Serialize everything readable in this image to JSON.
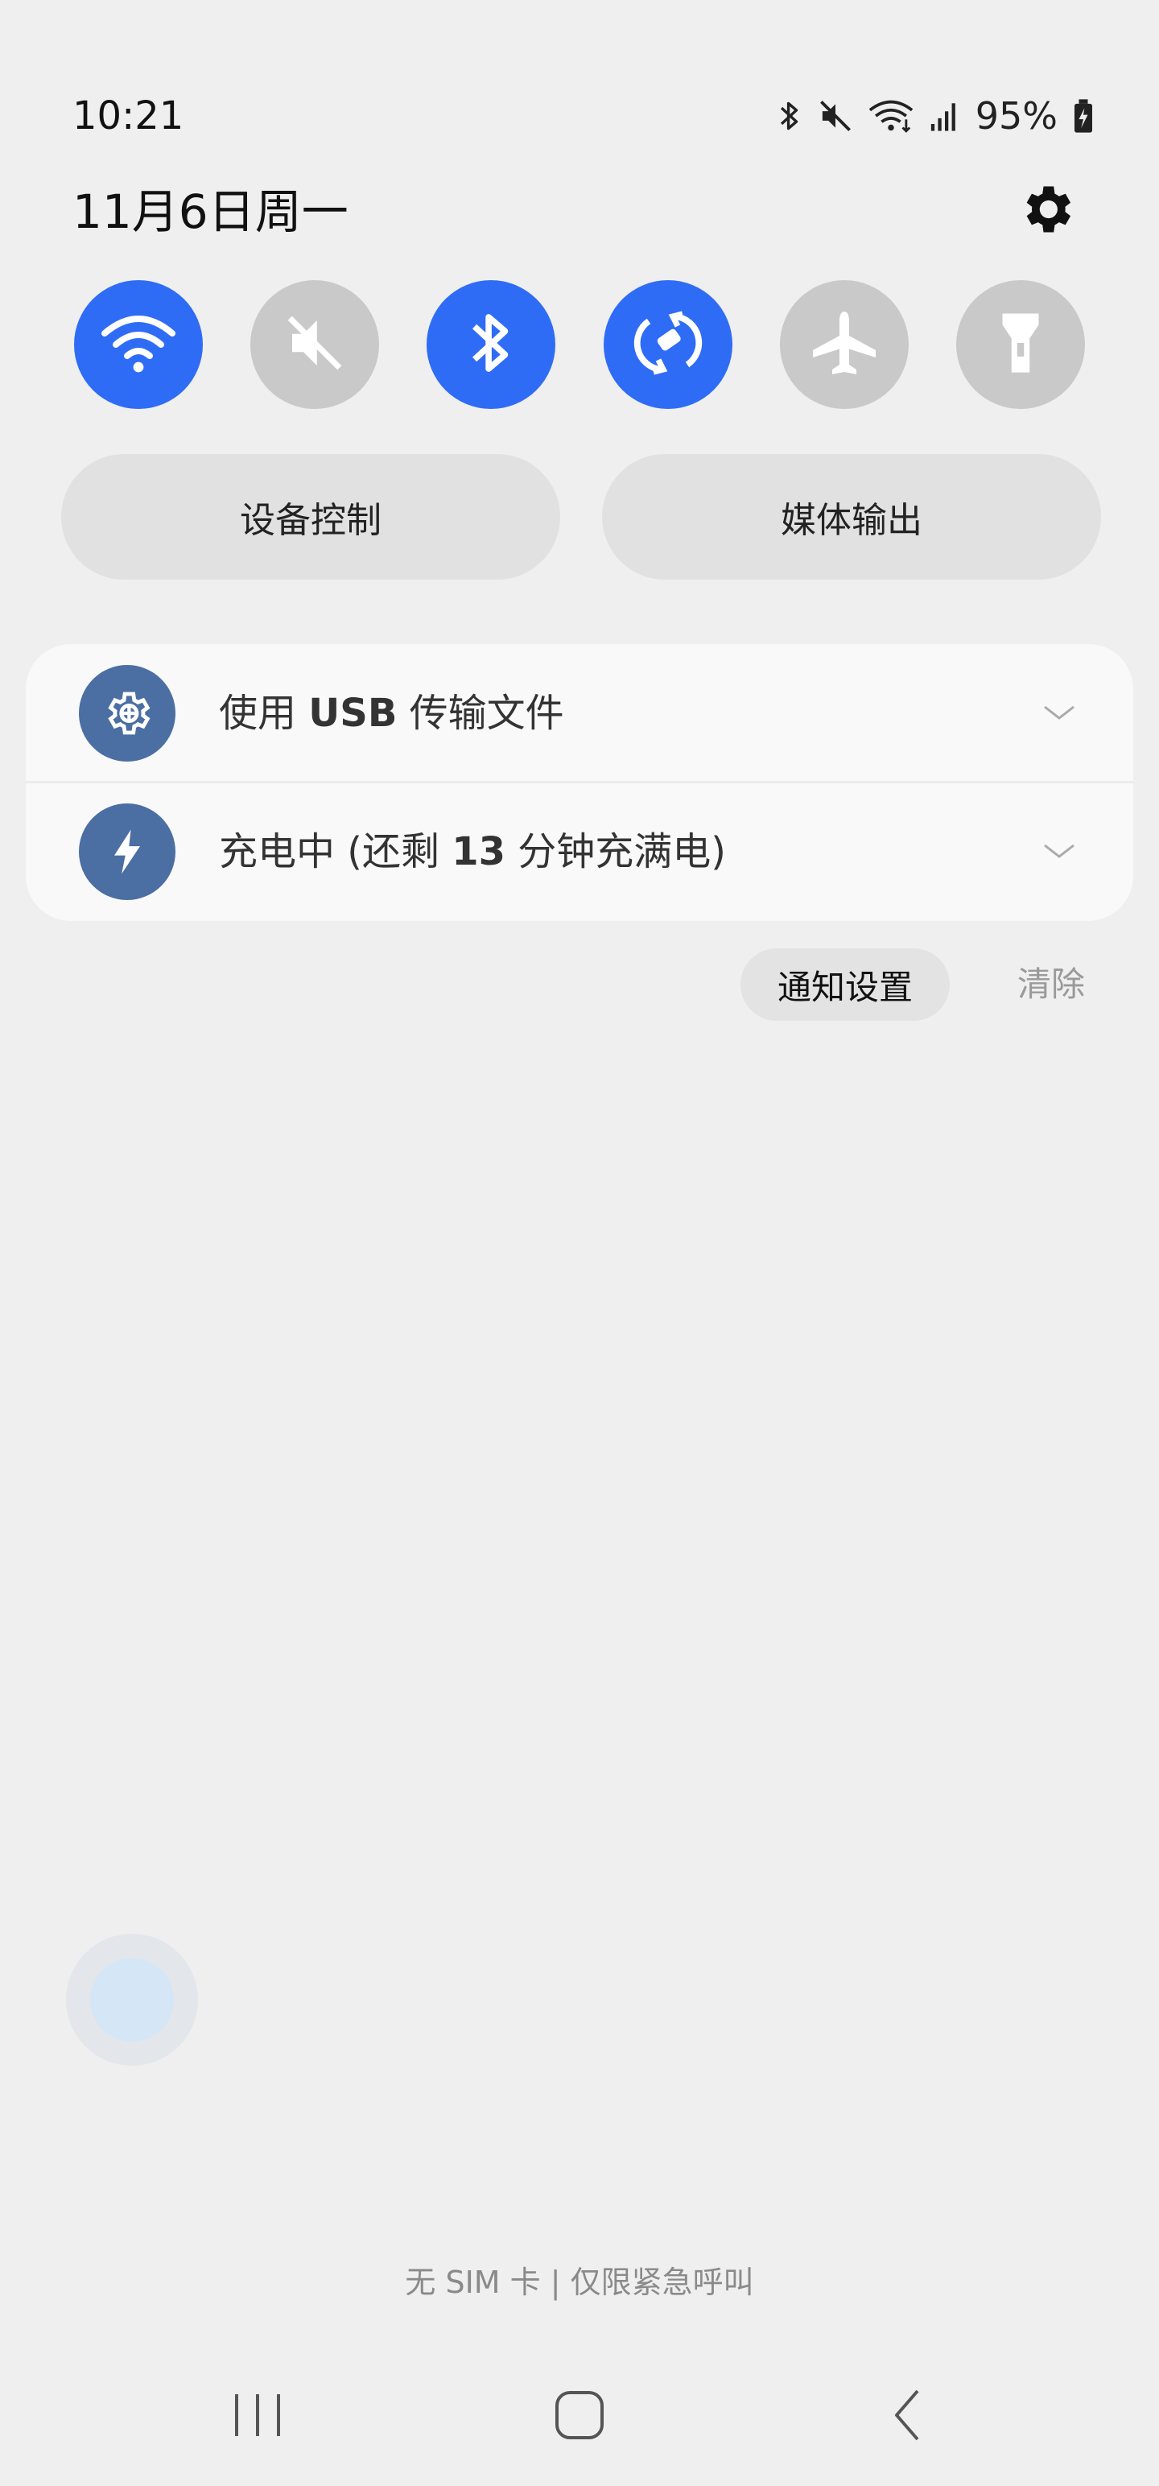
{
  "status_bar": {
    "time": "10:21",
    "battery_percent": "95%",
    "icons": [
      "bluetooth-icon",
      "mute-icon",
      "wifi-icon",
      "signal-icon",
      "battery-charging-icon"
    ]
  },
  "header": {
    "date": "11月6日周一",
    "settings_icon": "gear-icon"
  },
  "quick_toggles": [
    {
      "name": "wifi",
      "icon": "wifi-icon",
      "state": "on"
    },
    {
      "name": "sound",
      "icon": "mute-icon",
      "state": "off"
    },
    {
      "name": "bluetooth",
      "icon": "bluetooth-icon",
      "state": "on"
    },
    {
      "name": "auto-rotate",
      "icon": "rotate-icon",
      "state": "on"
    },
    {
      "name": "airplane",
      "icon": "airplane-icon",
      "state": "off"
    },
    {
      "name": "flashlight",
      "icon": "flashlight-icon",
      "state": "off"
    }
  ],
  "pills": {
    "device_control": "设备控制",
    "media_output": "媒体输出"
  },
  "notifications": {
    "usb": {
      "prefix": "使用 ",
      "bold": "USB",
      "suffix": " 传输文件",
      "icon": "usb-settings-icon"
    },
    "charging": {
      "prefix": "充电中 (还剩 ",
      "bold": "13",
      "suffix": " 分钟充满电)",
      "icon": "charging-bolt-icon"
    }
  },
  "actions": {
    "notification_settings": "通知设置",
    "clear": "清除"
  },
  "carrier_text": "无 SIM 卡 | 仅限紧急呼叫",
  "colors": {
    "background": "#efefef",
    "toggle_on": "#2f6cf6",
    "toggle_off": "#c9c9c9",
    "notif_icon_bg": "#4b6ea3"
  }
}
